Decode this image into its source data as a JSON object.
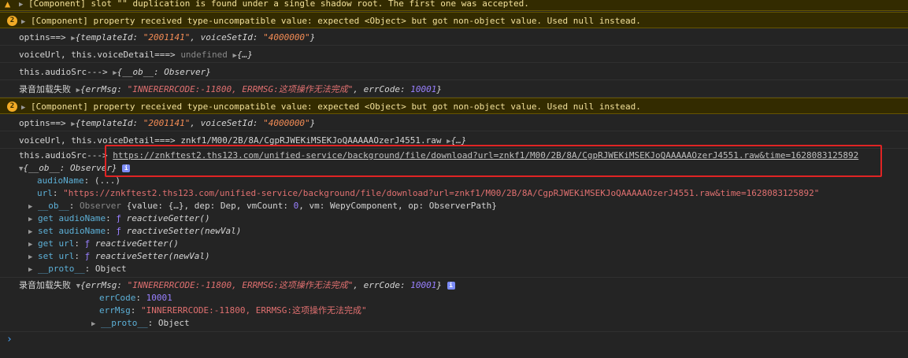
{
  "top_warn": "[Component] slot \"\" duplication is found under a single shadow root. The first one was accepted.",
  "warn_count": "2",
  "warn_type": "[Component] property received type-uncompatible value: expected <Object> but got non-object value. Used null instead.",
  "log1": {
    "prefix": "optins==>",
    "obj": "{templateId: ",
    "v1": "\"2001141\"",
    "mid": ", voiceSetId: ",
    "v2": "\"4000000\"",
    "end": "}"
  },
  "log2": {
    "prefix": "voiceUrl, this.voiceDetail===>",
    "undef": "undefined",
    "obj": "{…}"
  },
  "log3": {
    "prefix": "this.audioSrc--->",
    "obj": "{__ob__: Observer}"
  },
  "log4": {
    "prefix": "录音加载失败",
    "a": "{errMsg: ",
    "msg": "\"INNERERRCODE:-11800, ERRMSG:这项操作无法完成\"",
    "b": ", errCode: ",
    "code": "10001",
    "c": "}"
  },
  "log6": {
    "prefix": "voiceUrl, this.voiceDetail===>",
    "path": "znkf1/M00/2B/8A/CgpRJWEKiMSEKJoQAAAAAOzerJ4551.raw",
    "obj": "{…}"
  },
  "log7": {
    "prefix": "this.audioSrc--->",
    "url": "https://znkftest2.ths123.com/unified-service/background/file/download?url=znkf1/M00/2B/8A/CgpRJWEKiMSEKJoQAAAAAOzerJ4551.raw&time=1628083125892"
  },
  "ob": {
    "head": "{__ob__: Observer}",
    "audioName_k": "audioName",
    "audioName_v": "(...)",
    "url_k": "url",
    "url_v": "\"https://znkftest2.ths123.com/unified-service/background/file/download?url=znkf1/M00/2B/8A/CgpRJWEKiMSEKJoQAAAAAOzerJ4551.raw&time=1628083125892\"",
    "obk": "__ob__",
    "obv1": "Observer ",
    "obv2": "{value: {…}, dep: Dep, vmCount: ",
    "obv3": "0",
    "obv4": ", vm: WepyComponent, op: ObserverPath}",
    "g1k": "get audioName",
    "g1v": "reactiveGetter()",
    "s1k": "set audioName",
    "s1v": "reactiveSetter(newVal)",
    "g2k": "get url",
    "g2v": "reactiveGetter()",
    "s2k": "set url",
    "s2v": "reactiveSetter(newVal)",
    "protok": "__proto__",
    "protov": "Object",
    "f": "ƒ"
  },
  "err": {
    "code_k": "errCode",
    "code_v": "10001",
    "msg_k": "errMsg",
    "msg_v": "\"INNERERRCODE:-11800, ERRMSG:这项操作无法完成\"",
    "proto_k": "__proto__",
    "proto_v": "Object"
  },
  "prompt": "›",
  "info_i": "i"
}
